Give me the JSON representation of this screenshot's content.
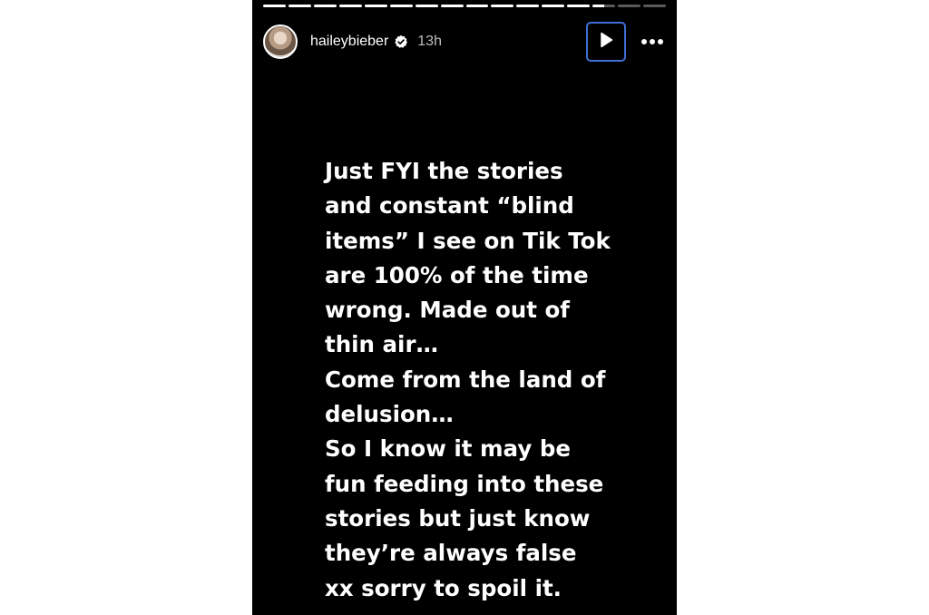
{
  "story": {
    "progress": [
      1,
      1,
      1,
      1,
      1,
      1,
      1,
      1,
      1,
      1,
      1,
      1,
      1,
      0.5,
      0,
      0
    ],
    "header": {
      "username": "haileybieber",
      "time": "13h"
    },
    "icons": {
      "verified": "verified-badge-icon",
      "play": "play-icon",
      "more": "more-options-icon"
    },
    "text_lines": [
      "Just FYI the stories",
      "and constant “blind",
      "items” I see on Tik Tok",
      "are 100% of the time",
      "wrong. Made out of",
      "thin air…",
      "Come from the land of",
      "delusion…",
      "So I know it may be",
      "fun feeding into these",
      "stories but just know",
      "they’re always false",
      "xx sorry to spoil it."
    ]
  }
}
